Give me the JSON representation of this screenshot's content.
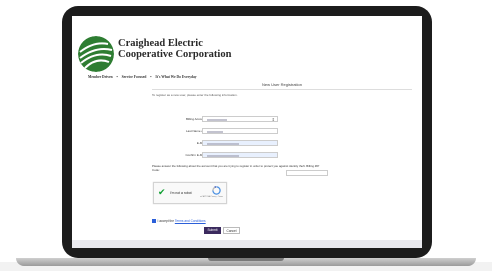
{
  "header": {
    "brand_line1": "Craighead Electric",
    "brand_line2": "Cooperative Corporation",
    "nav": [
      "Member Driven",
      "Service Focused",
      "It's What We Do Everyday"
    ]
  },
  "form": {
    "title": "New User Registration",
    "intro": "To register as a new user, please enter the following information.",
    "fields": [
      {
        "label": "Billing Account Number"
      },
      {
        "label": "Last Name or Business"
      },
      {
        "label": "E-Mail Address"
      },
      {
        "label": "Confirm E-Mail Address"
      }
    ],
    "account_note": "Please answer the following about the account that you are trying to register in order to protect you against identity theft.",
    "zip_label": "Billing ZIP Code:",
    "captcha": {
      "label": "I'm not a robot",
      "brand": "reCAPTCHA",
      "sub": "Privacy - Terms"
    },
    "agree_prefix": "I accept the",
    "agree_link": "Terms and Conditions",
    "submit_label": "Submit",
    "cancel_label": "Cancel"
  },
  "colors": {
    "accent": "#3b2a5e",
    "link": "#2b5fd9",
    "logo_green": "#2e7d32"
  }
}
